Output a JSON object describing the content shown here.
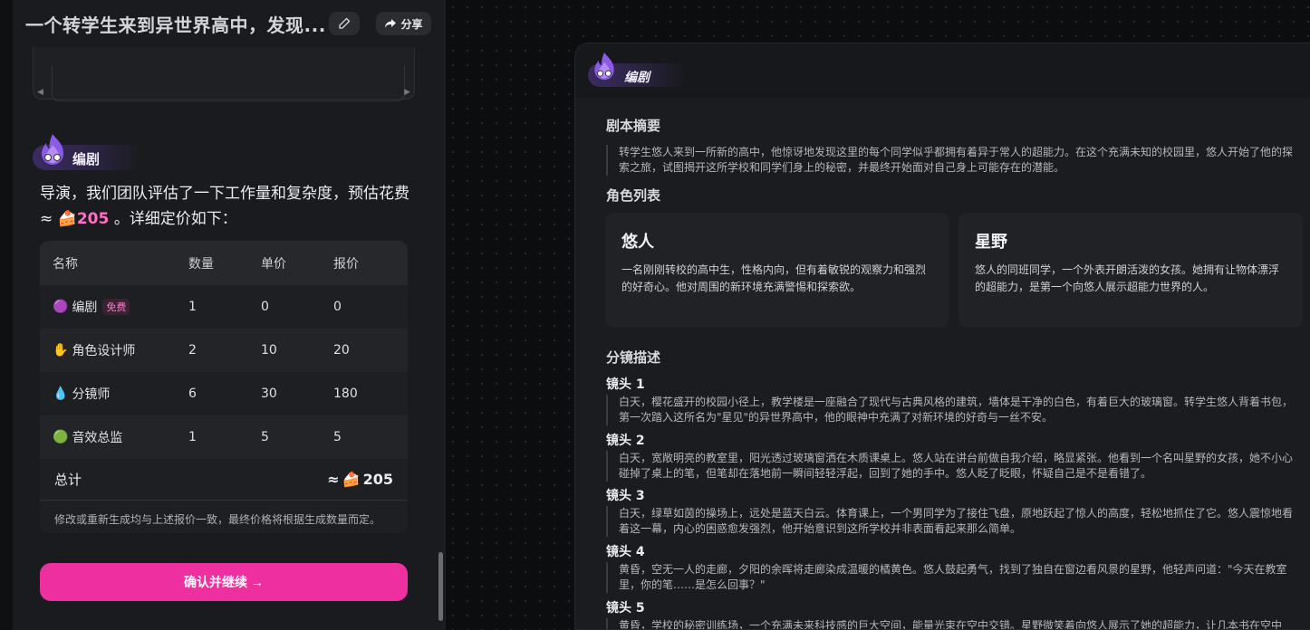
{
  "header": {
    "title": "一个转学生来到异世界高中，发现...",
    "share_label": "分享"
  },
  "left_agent": {
    "name": "编剧"
  },
  "message": {
    "prefix": "导演，我们团队评估了一下工作量和复杂度，预估花费 ≈ ",
    "price": "205",
    "suffix": " 。详细定价如下："
  },
  "pricing": {
    "headers": [
      "名称",
      "数量",
      "单价",
      "报价"
    ],
    "rows": [
      {
        "icon": "purple-flame-icon",
        "name": "编剧",
        "badge": "免费",
        "qty": "1",
        "unit": "0",
        "total": "0"
      },
      {
        "icon": "yellow-hand-icon",
        "name": "角色设计师",
        "badge": "",
        "qty": "2",
        "unit": "10",
        "total": "20"
      },
      {
        "icon": "blue-flame-icon",
        "name": "分镜师",
        "badge": "",
        "qty": "6",
        "unit": "30",
        "total": "180"
      },
      {
        "icon": "green-figure-icon",
        "name": "音效总监",
        "badge": "",
        "qty": "1",
        "unit": "5",
        "total": "5"
      }
    ],
    "total_label": "总计",
    "total_value": "205",
    "note": "修改或重新生成均与上述报价一致，最终价格将根据生成数量而定。"
  },
  "confirm_label": "确认并继续 →",
  "right_panel": {
    "agent_name": "编剧",
    "summary_title": "剧本摘要",
    "summary": "转学生悠人来到一所新的高中，他惊讶地发现这里的每个同学似乎都拥有着异于常人的超能力。在这个充满未知的校园里，悠人开始了他的探索之旅，试图揭开这所学校和同学们身上的秘密，并最终开始面对自己身上可能存在的潜能。",
    "roles_title": "角色列表",
    "roles": [
      {
        "name": "悠人",
        "desc": "一名刚刚转校的高中生，性格内向，但有着敏锐的观察力和强烈的好奇心。他对周围的新环境充满警惕和探索欲。"
      },
      {
        "name": "星野",
        "desc": "悠人的同班同学，一个外表开朗活泼的女孩。她拥有让物体漂浮的超能力，是第一个向悠人展示超能力世界的人。"
      }
    ],
    "shots_title": "分镜描述",
    "shots": [
      {
        "title": "镜头 1",
        "desc": "白天，樱花盛开的校园小径上，教学楼是一座融合了现代与古典风格的建筑，墙体是干净的白色，有着巨大的玻璃窗。转学生悠人背着书包，第一次踏入这所名为\"星见\"的异世界高中，他的眼神中充满了对新环境的好奇与一丝不安。"
      },
      {
        "title": "镜头 2",
        "desc": "白天，宽敞明亮的教室里，阳光透过玻璃窗洒在木质课桌上。悠人站在讲台前做自我介绍，略显紧张。他看到一个名叫星野的女孩，她不小心碰掉了桌上的笔，但笔却在落地前一瞬间轻轻浮起，回到了她的手中。悠人眨了眨眼，怀疑自己是不是看错了。"
      },
      {
        "title": "镜头 3",
        "desc": "白天，绿草如茵的操场上，远处是蓝天白云。体育课上，一个男同学为了接住飞盘，原地跃起了惊人的高度，轻松地抓住了它。悠人震惊地看着这一幕，内心的困惑愈发强烈，他开始意识到这所学校并非表面看起来那么简单。"
      },
      {
        "title": "镜头 4",
        "desc": "黄昏，空无一人的走廊，夕阳的余晖将走廊染成温暖的橘黄色。悠人鼓起勇气，找到了独自在窗边看风景的星野，他轻声问道：\"今天在教室里，你的笔……是怎么回事？\""
      },
      {
        "title": "镜头 5",
        "desc": "黄昏，学校的秘密训练场，一个充满未来科技感的巨大空间，能量光束在空中交错。星野微笑着向悠人展示了她的超能力，让几本书在空中"
      }
    ]
  }
}
